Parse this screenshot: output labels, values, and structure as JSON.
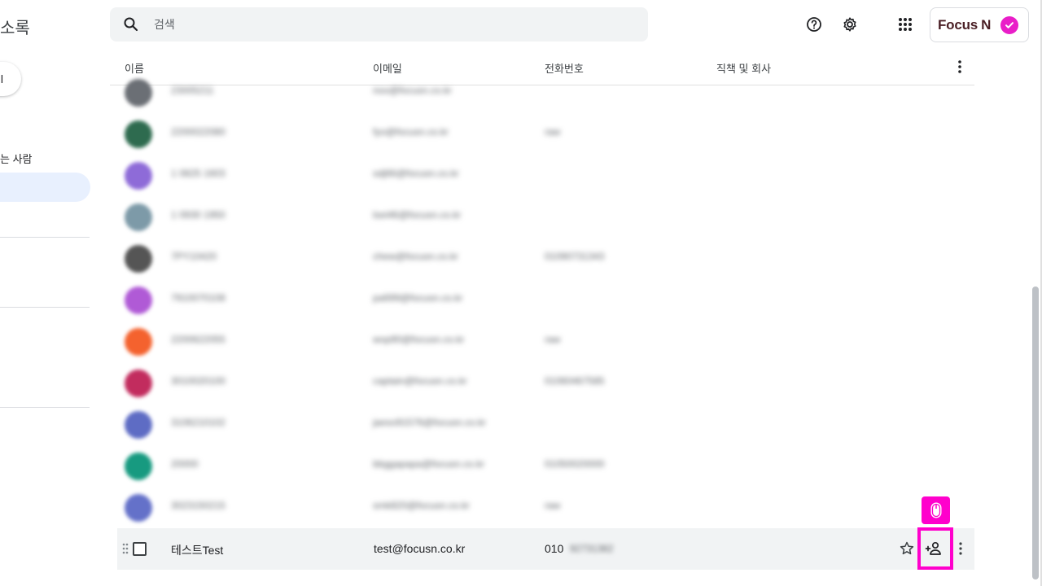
{
  "sidebar": {
    "title": "소록",
    "create_label": "l",
    "section_label": "는 사람"
  },
  "search": {
    "placeholder": "검색"
  },
  "topbar": {
    "icons": [
      "help-icon",
      "settings-icon",
      "apps-icon"
    ],
    "brand": {
      "text": "Focus",
      "mark": "N"
    }
  },
  "table": {
    "columns": [
      "이름",
      "이메일",
      "전화번호",
      "직책 및 회사"
    ],
    "blurred_rows": [
      {
        "avatar_color": "#6b6f75",
        "name": "23005211",
        "email": "noo@focusn.co.kr",
        "phone": ""
      },
      {
        "avatar_color": "#2e6b4f",
        "name": "2200022080",
        "email": "fyo@focusn.co.kr",
        "phone": "raw"
      },
      {
        "avatar_color": "#8e6bd8",
        "name": "1 0825 1603",
        "email": "sdj66@focusn.co.kr",
        "phone": ""
      },
      {
        "avatar_color": "#7d9aa8",
        "name": "1 0930 1950",
        "email": "lsei46@focusn.co.kr",
        "phone": ""
      },
      {
        "avatar_color": "#555555",
        "name": "7PY10420",
        "email": "chew@focusn.co.kr",
        "phone": "01090731343"
      },
      {
        "avatar_color": "#b05ad6",
        "name": "7910070108",
        "email": "pa699@focusn.co.kr",
        "phone": ""
      },
      {
        "avatar_color": "#f4622e",
        "name": "2200622055",
        "email": "wop90@focusn.co.kr",
        "phone": "raw"
      },
      {
        "avatar_color": "#c22c5e",
        "name": "3010020100",
        "email": "captain@focusn.co.kr",
        "phone": "01060467585"
      },
      {
        "avatar_color": "#5e6cc4",
        "name": "3106210102",
        "email": "jaeso91576@focusn.co.kr",
        "phone": ""
      },
      {
        "avatar_color": "#179a80",
        "name": "20000",
        "email": "bbggapapa@focusn.co.kr",
        "phone": "01050020000"
      },
      {
        "avatar_color": "#6471c9",
        "name": "3023150215",
        "email": "smk820@focusn.co.kr",
        "phone": "raw"
      }
    ],
    "focused_row": {
      "name": "테스트Test",
      "email": "test@focusn.co.kr",
      "phone_prefix": "010",
      "phone_blurred": "92731382"
    }
  },
  "colors": {
    "highlight": "#ff00cc",
    "active_nav": "#e8f0fe"
  }
}
